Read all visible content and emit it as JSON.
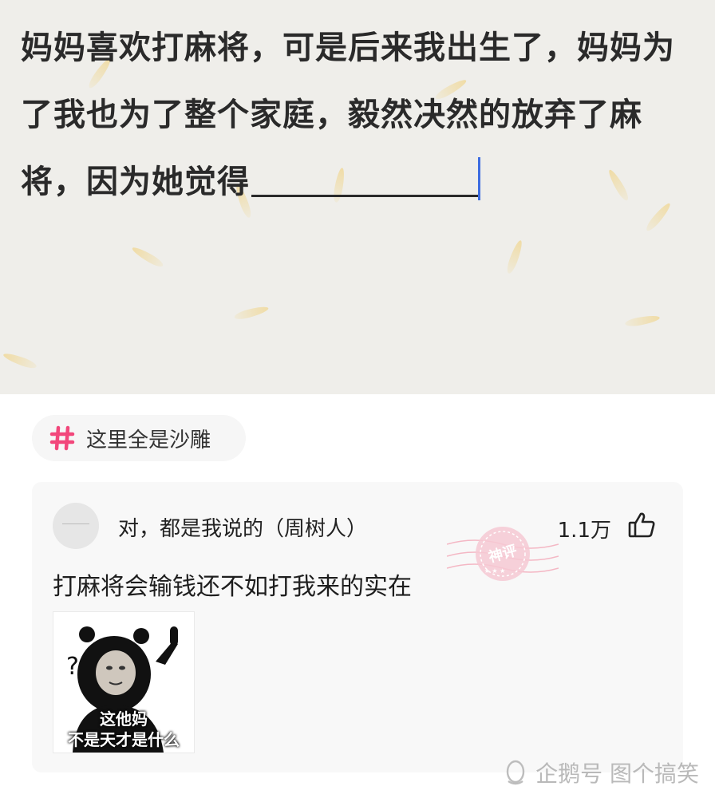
{
  "question": {
    "line1": "妈妈喜欢打麻将，可是后来我出生了，妈妈为",
    "line2": "了我也为了整个家庭，毅然决然的放弃了麻",
    "line3": "将，因为她觉得"
  },
  "tag": {
    "label": "这里全是沙雕",
    "accent": "#f2477b"
  },
  "comment_card": {
    "username": "对，都是我说的（周树人）",
    "likes": "1.1万",
    "badge_text": "神评",
    "body": "打麻将会输钱还不如打我来的实在",
    "meme": {
      "caption_line1": "这他妈",
      "caption_line2": "不是天才是什么",
      "question_mark": "?"
    }
  },
  "watermark": {
    "text": "企鹅号 图个搞笑"
  }
}
